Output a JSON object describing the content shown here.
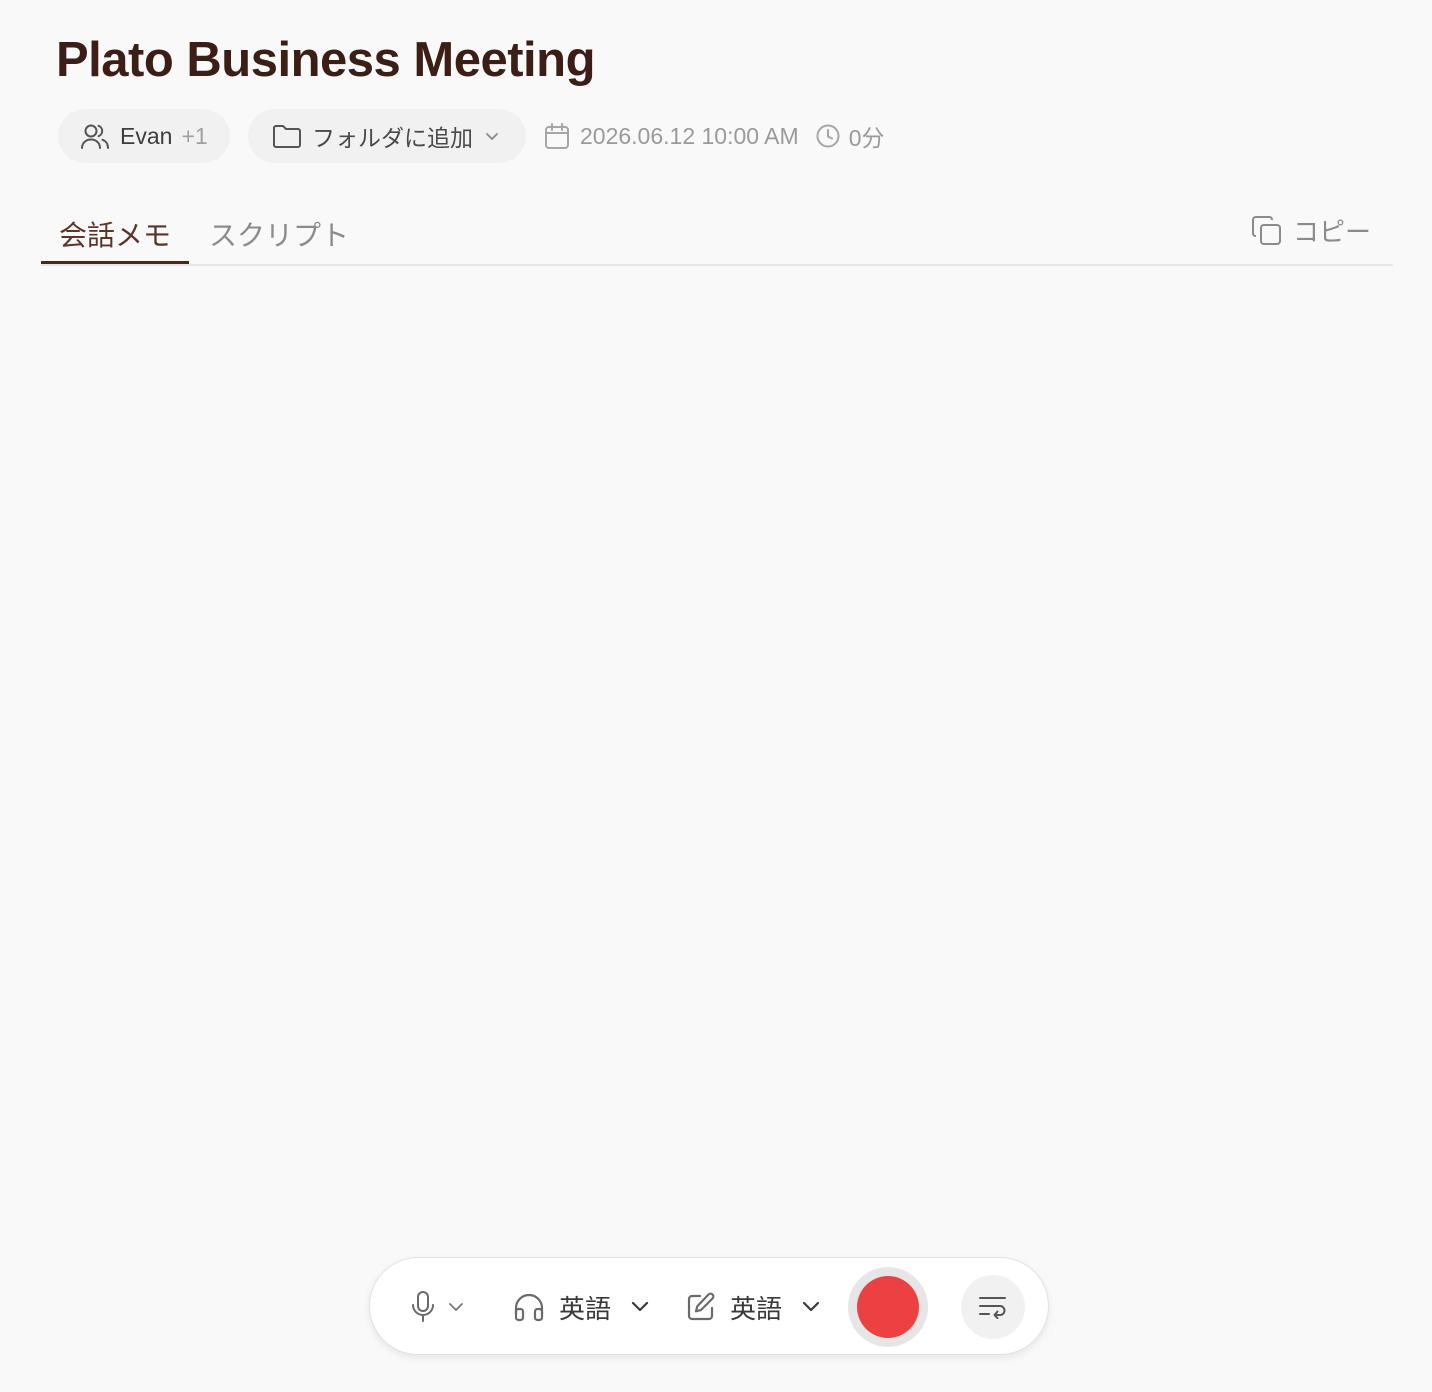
{
  "meeting": {
    "title": "Plato Business Meeting",
    "participants": {
      "name": "Evan",
      "extra": "+1"
    },
    "folder_label": "フォルダに追加",
    "datetime": "2026.06.12 10:00 AM",
    "duration": "0分"
  },
  "tabs": [
    {
      "label": "会話メモ",
      "active": true
    },
    {
      "label": "スクリプト",
      "active": false
    }
  ],
  "copy_label": "コピー",
  "toolbar": {
    "listen_language": "英語",
    "write_language": "英語"
  },
  "colors": {
    "title": "#3b1f16",
    "active_tab": "#5a3529",
    "record": "#ec4143",
    "background": "#f9f9f9"
  },
  "icons": [
    "users-icon",
    "folder-icon",
    "chevron-down-icon",
    "calendar-icon",
    "clock-icon",
    "copy-icon",
    "microphone-icon",
    "headphones-icon",
    "edit-icon",
    "text-wrap-icon"
  ]
}
